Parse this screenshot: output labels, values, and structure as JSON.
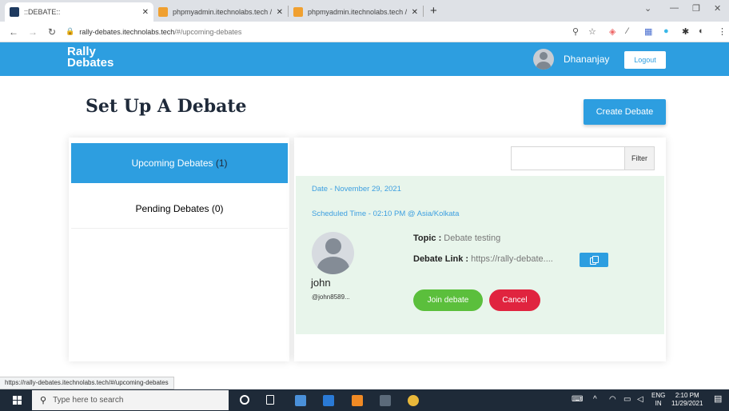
{
  "browser": {
    "tabs": [
      {
        "title": "::DEBATE::",
        "active": true
      },
      {
        "title": "phpmyadmin.itechnolabs.tech / ...",
        "active": false
      },
      {
        "title": "phpmyadmin.itechnolabs.tech / ...",
        "active": false
      }
    ],
    "url_host": "rally-debates.itechnolabs.tech",
    "url_path": "/#/upcoming-debates",
    "status_url": "https://rally-debates.itechnolabs.tech/#/upcoming-debates"
  },
  "header": {
    "logo_line1": "Rally",
    "logo_line2": "Debates",
    "username": "Dhananjay",
    "logout_label": "Logout"
  },
  "page": {
    "title": "Set Up A Debate",
    "create_label": "Create Debate"
  },
  "sidebar": {
    "items": [
      {
        "label": "Upcoming Debates",
        "count": "(1)",
        "active": true
      },
      {
        "label": "Pending Debates",
        "count": "(0)",
        "active": false
      }
    ]
  },
  "filter": {
    "placeholder": "",
    "button_label": "Filter"
  },
  "debate": {
    "date": "Date - November 29, 2021",
    "scheduled": "Scheduled Time - 02:10 PM @ Asia/Kolkata",
    "host_name": "john",
    "host_handle": "@john8589...",
    "topic_label": "Topic :",
    "topic_value": "Debate testing",
    "link_label": "Debate Link :",
    "link_value": "https://rally-debate....",
    "join_label": "Join debate",
    "cancel_label": "Cancel"
  },
  "taskbar": {
    "search_placeholder": "Type here to search",
    "lang_top": "ENG",
    "lang_bottom": "IN",
    "time": "2:10 PM",
    "date": "11/29/2021"
  },
  "colors": {
    "brand": "#2d9ee0",
    "join": "#5bbf3c",
    "cancel": "#e0243f",
    "card_bg": "#e8f5eb"
  }
}
